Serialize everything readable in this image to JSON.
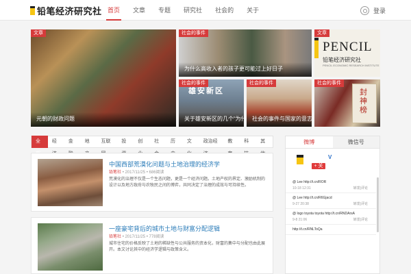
{
  "header": {
    "logo_text": "铅笔经济研究社",
    "nav": [
      "首页",
      "文章",
      "专题",
      "研究社",
      "社会的",
      "关于"
    ],
    "login": "登录"
  },
  "hero": [
    {
      "tag": "文章",
      "caption": "元朝的财政问题"
    },
    {
      "tag": "社会的事件",
      "caption": "为什么高收入者的孩子更可能过上好日子"
    },
    {
      "tag": "文章",
      "banner_big": "PENCIL",
      "banner_sub": "铅笔经济研究社",
      "banner_tiny": "PENCIL ECONOMIC RESEARCH INSTITUTE"
    },
    {
      "tag": "社会的事件",
      "caption": "关于雄安新区的几个“为什么”",
      "image_text": "雄安新区"
    },
    {
      "tag": "社会的事件",
      "caption": "社会的事件与国家的意志"
    },
    {
      "tag": "社会的事件",
      "book_text": "封神榜"
    }
  ],
  "tabs": [
    "全部",
    "经济",
    "金融",
    "地产",
    "互联网",
    "投资",
    "创业",
    "社会",
    "历史",
    "文化",
    "政治经济",
    "教育",
    "科技",
    "其他"
  ],
  "articles": [
    {
      "title": "中国西部荒漠化问题与土地治理的经济学",
      "source": "铅笔社",
      "date": "2017/11/25",
      "views": "686阅读",
      "desc": "荒漠化的治理不仅是一个生态问题，更是一个经济问题。土地产权的界定、激励机制的设计以及地方政府与农牧民之间的博弈，共同决定了治理的成效与可持续性。"
    },
    {
      "title": "一座豪宅背后的城市土地与财富分配逻辑",
      "source": "铅笔社",
      "date": "2017/11/25",
      "views": "778阅读",
      "desc": "城市住宅的价格反映了土地的稀缺性与公共服务的资本化，财富的集中与分配也由此展开。本文讨论其中的经济学逻辑与政策含义。"
    }
  ],
  "sidebar": {
    "tabs": [
      "微博",
      "微信号"
    ],
    "follow_label": "+ 关注",
    "verified_mark": "V",
    "posts": [
      {
        "text": "@ Lee http://t.cn/ROR",
        "time": "10-18 12:31",
        "more": "转发|评论"
      },
      {
        "text": "@ Lee http://t.cn/R6Gjacd",
        "time": "9-27 20:38",
        "more": "转发|评论"
      },
      {
        "text": "@ logo toyota toyota http://t.cn/RNDArsA",
        "time": "9-8 21:06",
        "more": "转发|评论"
      },
      {
        "text": "http://t.cn/RNLToQa",
        "time": "",
        "more": ""
      }
    ]
  },
  "colors": {
    "accent": "#d63b3b",
    "link": "#2a7bb8",
    "brand_yellow": "#f6c513"
  }
}
